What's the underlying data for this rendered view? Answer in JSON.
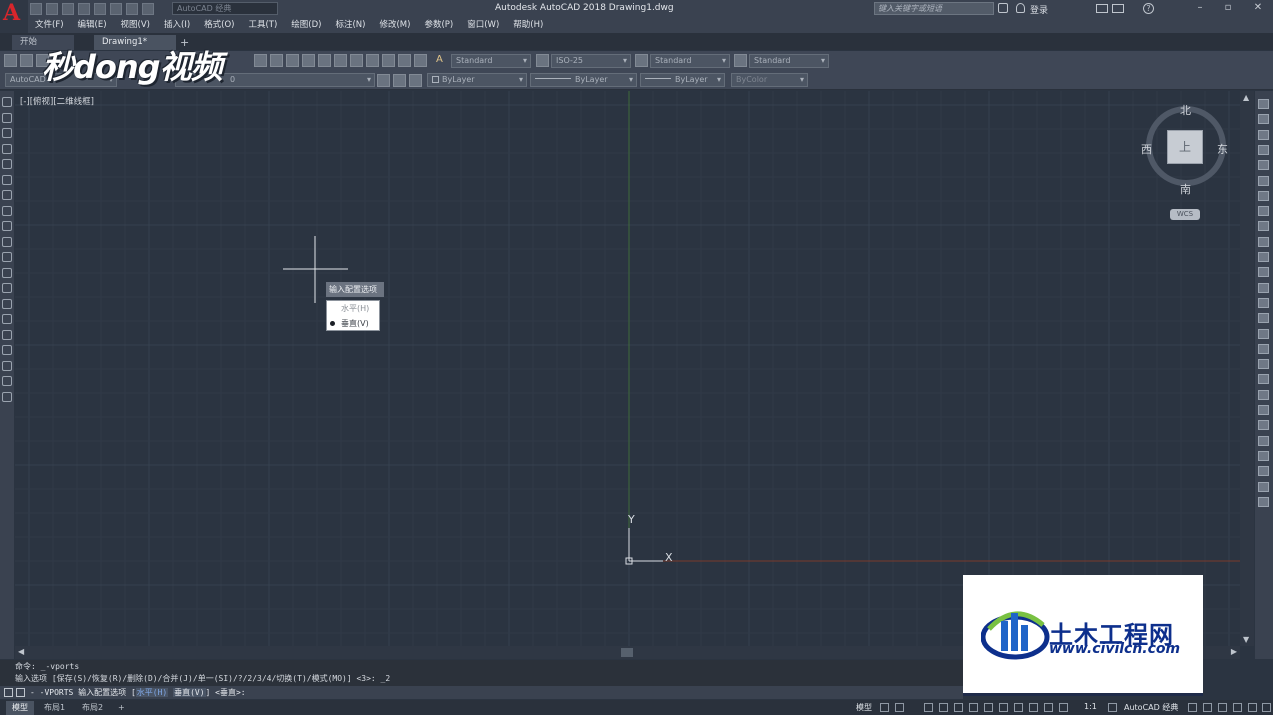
{
  "app": {
    "logo_letter": "A",
    "title": "Autodesk AutoCAD 2018    Drawing1.dwg",
    "workspace": "AutoCAD 经典",
    "search_placeholder": "键入关键字或短语",
    "login": "登录"
  },
  "menu": [
    "文件(F)",
    "编辑(E)",
    "视图(V)",
    "插入(I)",
    "格式(O)",
    "工具(T)",
    "绘图(D)",
    "标注(N)",
    "修改(M)",
    "参数(P)",
    "窗口(W)",
    "帮助(H)"
  ],
  "file_tabs": {
    "start": "开始",
    "drawing": "Drawing1*",
    "add": "+"
  },
  "toolbar": {
    "text_style": "Standard",
    "dim_style": "ISO-25",
    "table_style": "Standard",
    "multileader_style": "Standard",
    "workspace_label": "AutoCAD",
    "layer": "0",
    "color": "ByLayer",
    "linetype": "ByLayer",
    "lineweight": "ByLayer",
    "plot_style": "ByColor"
  },
  "watermark": "秒dong视频",
  "viewport_label": "[-][俯视][二维线框]",
  "context_menu": {
    "prompt": "输入配置选项",
    "options": [
      "水平(H)",
      "垂直(V)"
    ],
    "selected": "垂直(V)"
  },
  "viewcube": {
    "north": "北",
    "south": "南",
    "west": "西",
    "east": "东",
    "face": "上",
    "wcs": "WCS"
  },
  "ucs": {
    "x": "X",
    "y": "Y"
  },
  "command": {
    "history_1": "命令: _-vports",
    "history_2": "输入选项 [保存(S)/恢复(R)/删除(D)/合并(J)/单一(SI)/?/2/3/4/切换(T)/模式(MO)] <3>: _2",
    "input_prefix": "- -VPORTS 输入配置选项 [",
    "opt_h": "水平(H)",
    "opt_v": "垂直(V)",
    "input_suffix": "] <垂直>:"
  },
  "layout_tabs": [
    "模型",
    "布局1",
    "布局2",
    "+"
  ],
  "status": {
    "model": "模型",
    "scale": "1:1",
    "workspace": "AutoCAD 经典"
  },
  "civil_logo": {
    "title": "土木工程网",
    "url": "www.civilcn.com"
  },
  "colors": {
    "canvas": "#2b3441",
    "grid": "#35404e",
    "x_axis": "#8a3a2a",
    "y_axis": "#3a6a3a",
    "accent": "#d8262c",
    "logo_blue": "#0d2f8c"
  }
}
